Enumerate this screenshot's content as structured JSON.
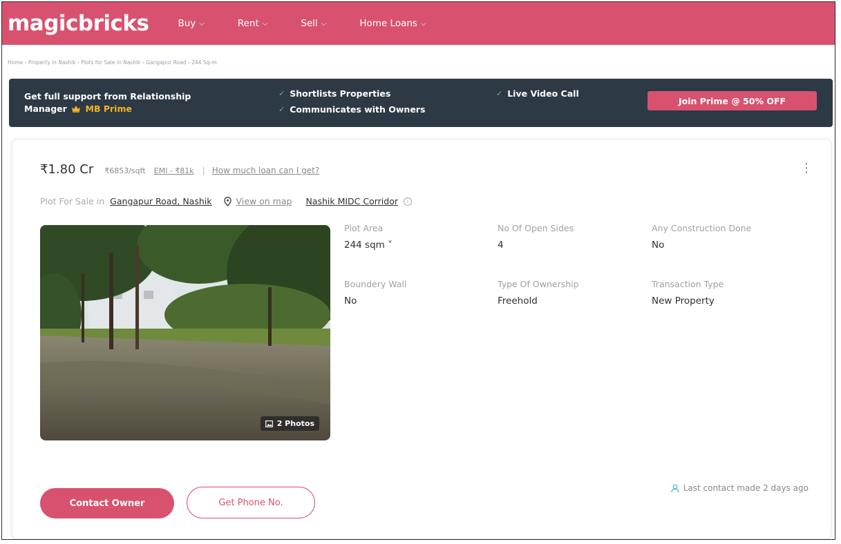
{
  "header": {
    "logo": "magicbricks",
    "nav": [
      {
        "label": "Buy"
      },
      {
        "label": "Rent"
      },
      {
        "label": "Sell"
      },
      {
        "label": "Home Loans"
      }
    ]
  },
  "breadcrumb": "Home › Property in Nashik › Plots for Sale in Nashik › Gangapur Road › 244 Sq-m",
  "prime": {
    "title_line1": "Get full support from Relationship",
    "title_line2_prefix": "Manager",
    "title_line2_brand": "MB Prime",
    "benefits": [
      "Shortlists Properties",
      "Communicates with Owners",
      "Live Video Call"
    ],
    "cta": "Join Prime @ 50% OFF"
  },
  "listing": {
    "price": "₹1.80 Cr",
    "price_per_sqft": "₹6853/sqft",
    "emi": "EMI - ₹81k",
    "loan_link": "How much loan can I get?",
    "location_prefix": "Plot For Sale in",
    "location": "Gangapur Road, Nashik",
    "view_map": "View on map",
    "corridor": "Nashik MIDC Corridor",
    "photos_label": "2 Photos",
    "specs": [
      {
        "label": "Plot Area",
        "value": "244 sqm ˅"
      },
      {
        "label": "No Of Open Sides",
        "value": "4"
      },
      {
        "label": "Any Construction Done",
        "value": "No"
      },
      {
        "label": "Boundery Wall",
        "value": "No"
      },
      {
        "label": "Type Of Ownership",
        "value": "Freehold"
      },
      {
        "label": "Transaction Type",
        "value": "New Property"
      }
    ],
    "contact_owner": "Contact Owner",
    "get_phone": "Get Phone No.",
    "last_contact": "Last contact made 2 days ago"
  },
  "icons": {
    "crown": "crown-icon",
    "tick": "check-icon",
    "more": "more-vertical-icon",
    "pin": "map-pin-icon",
    "info": "info-icon",
    "camera": "gallery-icon",
    "user": "user-icon"
  },
  "colors": {
    "brand": "#d8526f",
    "banner": "#2d3944",
    "gold": "#f2b428",
    "tick": "#59c07a",
    "user_icon": "#3fb8c8"
  }
}
